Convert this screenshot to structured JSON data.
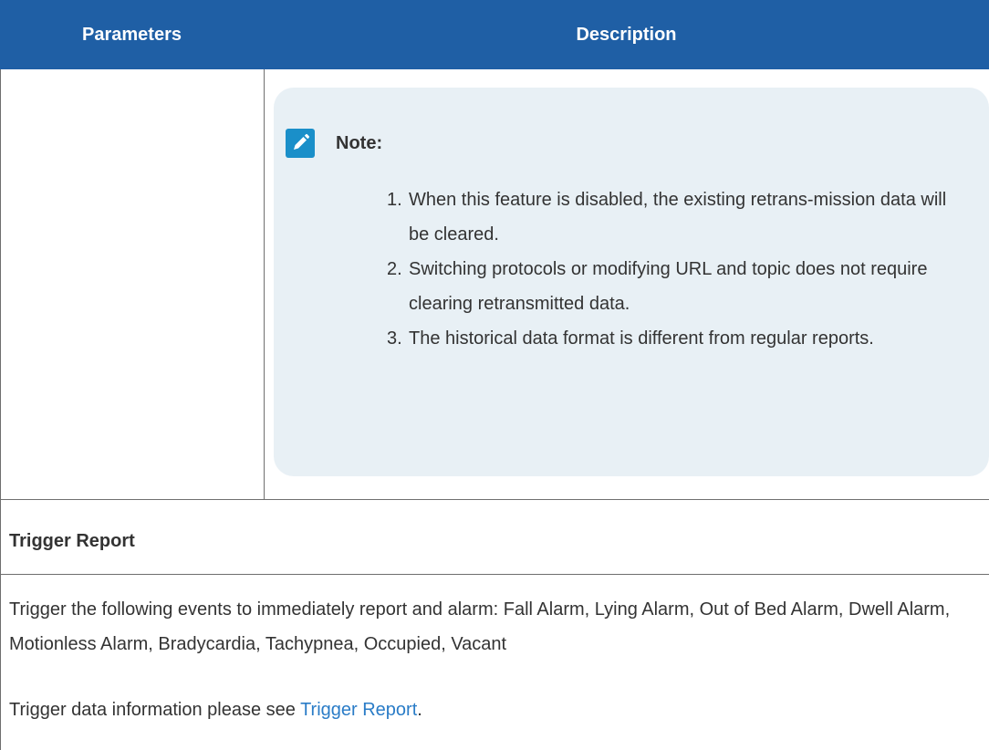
{
  "table": {
    "headers": {
      "parameters": "Parameters",
      "description": "Description"
    }
  },
  "note": {
    "icon": "pencil-note-icon",
    "title": "Note:",
    "items": [
      {
        "num": "1.",
        "text": "When this feature is disabled, the existing retrans-mission data will be cleared."
      },
      {
        "num": "2.",
        "text": "Switching protocols or modifying URL and topic does not require clearing retransmitted data."
      },
      {
        "num": "3.",
        "text": "The historical data format is different from regular reports."
      }
    ]
  },
  "trigger_report": {
    "title": "Trigger Report",
    "description": "Trigger the following events to immediately report and alarm: Fall Alarm, Lying Alarm, Out of Bed Alarm, Dwell Alarm, Motionless Alarm, Bradycardia, Tachypnea, Occupied, Vacant",
    "info_prefix": "Trigger data information please see ",
    "info_link": "Trigger Report",
    "info_suffix": "."
  },
  "colors": {
    "header_bg": "#1f5fa5",
    "note_bg": "#e8f0f5",
    "note_icon": "#1a8fc9",
    "link": "#2a7cc7"
  }
}
